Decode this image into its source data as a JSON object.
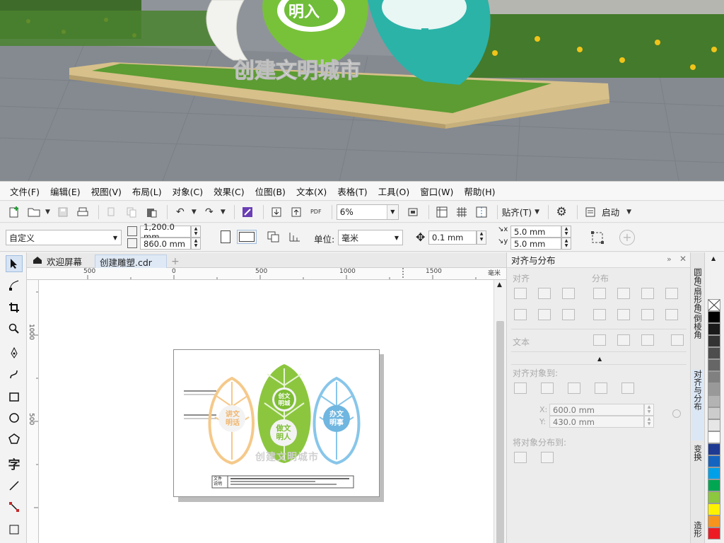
{
  "render": {
    "slogan": "创建文明城市",
    "sign_text": "明入"
  },
  "menubar": {
    "items": [
      "文件(F)",
      "编辑(E)",
      "视图(V)",
      "布局(L)",
      "对象(C)",
      "效果(C)",
      "位图(B)",
      "文本(X)",
      "表格(T)",
      "工具(O)",
      "窗口(W)",
      "帮助(H)"
    ]
  },
  "toolbar1": {
    "pdf_label": "PDF",
    "zoom_value": "6%",
    "snap_label": "贴齐(T)",
    "launch_label": "启动"
  },
  "toolbar2": {
    "paper_preset": "自定义",
    "width_value": "1,200.0 mm",
    "height_value": "860.0 mm",
    "unit_label": "单位:",
    "unit_value": "毫米",
    "nudge_value": "0.1 mm",
    "dup_x_value": "5.0 mm",
    "dup_y_value": "5.0 mm"
  },
  "tabs": {
    "welcome": "欢迎屏幕",
    "document": "创建雕塑.cdr",
    "add": "+"
  },
  "ruler": {
    "h_labels": [
      "500",
      "0",
      "500",
      "1000",
      "1500"
    ],
    "h_unit": "毫米",
    "v_labels": [
      "1000",
      "500"
    ]
  },
  "design": {
    "leaf_left_text_1": "讲文",
    "leaf_left_text_2": "明话",
    "leaf_mid_top_1": "创文",
    "leaf_mid_top_2": "明城",
    "leaf_mid_bottom_1": "做文",
    "leaf_mid_bottom_2": "明人",
    "leaf_right_text_1": "办文",
    "leaf_right_text_2": "明事",
    "slogan": "创建文明城市",
    "note_label_1": "文件",
    "note_label_2": "说明"
  },
  "docker": {
    "title": "对齐与分布",
    "align_label": "对齐",
    "distribute_label": "分布",
    "text_label": "文本",
    "align_to_label": "对齐对象到:",
    "x_prefix": "X:",
    "x_value": "600.0 mm",
    "y_prefix": "Y:",
    "y_value": "430.0 mm",
    "distribute_to_label": "将对象分布到:"
  },
  "vtabs": {
    "tab1": "圆角/扇形角/倒棱角",
    "tab2": "对齐与分布",
    "tab3": "变换",
    "tab4": "造形"
  },
  "palette": {
    "colors": [
      "#ffffff",
      "#000000",
      "#1a1a1a",
      "#333333",
      "#4d4d4d",
      "#666666",
      "#808080",
      "#999999",
      "#b3b3b3",
      "#cccccc",
      "#e6e6e6",
      "#ffffff",
      "#1f3a93",
      "#1565c0",
      "#00a0e9",
      "#00a651",
      "#8dc63f",
      "#fff200",
      "#f7941d",
      "#ed1c24"
    ]
  },
  "colors": {
    "accent": "#00a0e9",
    "leaf_orange": "#f5c98a",
    "leaf_green": "#8cc63f",
    "leaf_blue": "#88c6ea"
  }
}
